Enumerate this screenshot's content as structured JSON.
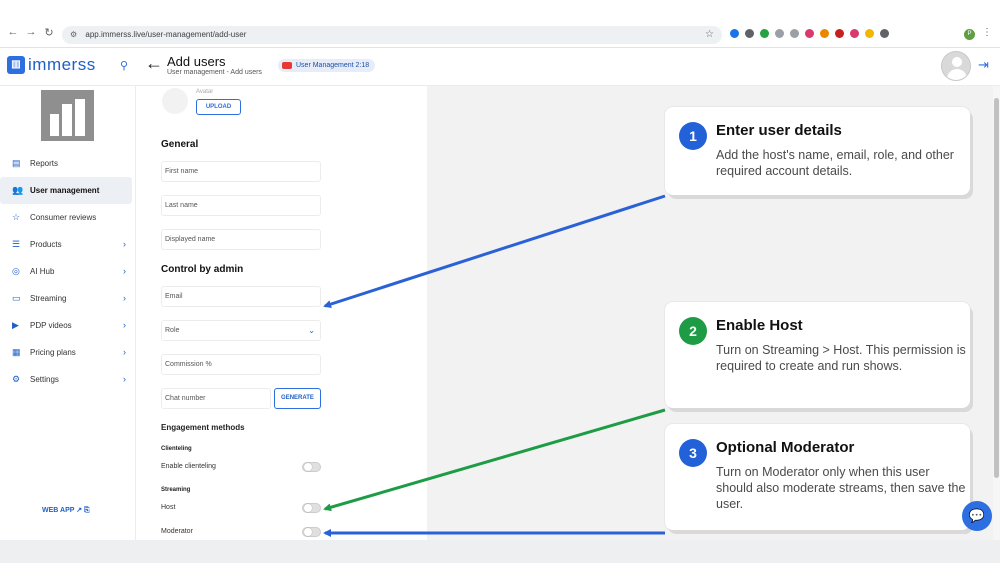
{
  "browser": {
    "url": "app.immerss.live/user-management/add-user",
    "back": "←",
    "forward": "→",
    "reload": "↻",
    "star": "☆"
  },
  "header": {
    "logo_text": "immerss",
    "title": "Add users",
    "breadcrumb": "User management - Add users",
    "video_badge": "User Management 2:18"
  },
  "sidebar": {
    "items": [
      {
        "label": "Reports",
        "icon": "reports-icon"
      },
      {
        "label": "User management",
        "icon": "users-icon"
      },
      {
        "label": "Consumer reviews",
        "icon": "star-icon"
      },
      {
        "label": "Products",
        "icon": "list-icon"
      },
      {
        "label": "AI Hub",
        "icon": "ai-icon"
      },
      {
        "label": "Streaming",
        "icon": "monitor-icon"
      },
      {
        "label": "PDP videos",
        "icon": "video-icon"
      },
      {
        "label": "Pricing plans",
        "icon": "pricing-icon"
      },
      {
        "label": "Settings",
        "icon": "gear-icon"
      }
    ],
    "web_app": "WEB APP"
  },
  "form": {
    "avatar_label": "Avatar",
    "upload": "UPLOAD",
    "general_heading": "General",
    "first_name": "First name",
    "last_name": "Last name",
    "displayed_name": "Displayed name",
    "control_heading": "Control by admin",
    "email": "Email",
    "role": "Role",
    "commission": "Commission %",
    "chat_number": "Chat number",
    "generate": "GENERATE",
    "engagement_heading": "Engagement methods",
    "clienteling_heading": "Clienteling",
    "enable_clienteling": "Enable clienteling",
    "streaming_heading": "Streaming",
    "host": "Host",
    "moderator": "Moderator"
  },
  "callouts": [
    {
      "number": "1",
      "title": "Enter user details",
      "text": "Add the host's name, email, role, and other required account details.",
      "color": "#2261d8"
    },
    {
      "number": "2",
      "title": "Enable Host",
      "text": "Turn on Streaming > Host. This permission is required to create and run shows.",
      "color": "#1e9c45"
    },
    {
      "number": "3",
      "title": "Optional Moderator",
      "text": "Turn on Moderator only when this user should also moderate streams, then save the user.",
      "color": "#2261d8"
    }
  ],
  "colors": {
    "accent": "#2d6fe0",
    "arrow_blue": "#2a62d6",
    "arrow_green": "#1e9c45"
  }
}
